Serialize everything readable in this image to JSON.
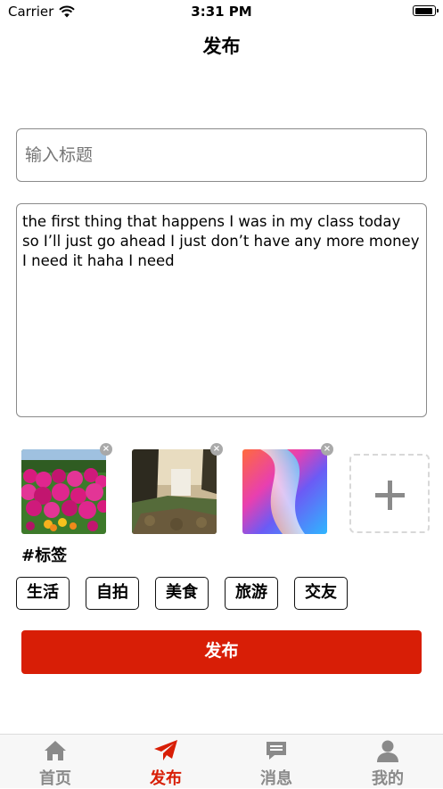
{
  "status_bar": {
    "carrier": "Carrier",
    "time": "3:31 PM",
    "battery_level": 0.95
  },
  "nav": {
    "title": "发布"
  },
  "form": {
    "title_placeholder": "输入标题",
    "content": "the first thing that happens I was in my class today so I’ll just go ahead I just don’t have any more money I need it haha I need"
  },
  "images": [
    {
      "name": "flower-garden-photo",
      "remove_label": "×"
    },
    {
      "name": "waterfall-photo",
      "remove_label": "×"
    },
    {
      "name": "gradient-wallpaper",
      "remove_label": "×"
    }
  ],
  "add_image_icon": "plus-icon",
  "tags": {
    "heading": "#标签",
    "items": [
      "生活",
      "自拍",
      "美食",
      "旅游",
      "交友"
    ]
  },
  "publish_button": "发布",
  "tabbar": {
    "items": [
      {
        "label": "首页",
        "icon": "home-icon",
        "active": false
      },
      {
        "label": "发布",
        "icon": "paper-plane-icon",
        "active": true
      },
      {
        "label": "消息",
        "icon": "message-icon",
        "active": false
      },
      {
        "label": "我的",
        "icon": "person-icon",
        "active": false
      }
    ]
  },
  "colors": {
    "accent": "#d81e06",
    "inactive": "#8a8a8a",
    "border": "#8a8a8a"
  }
}
